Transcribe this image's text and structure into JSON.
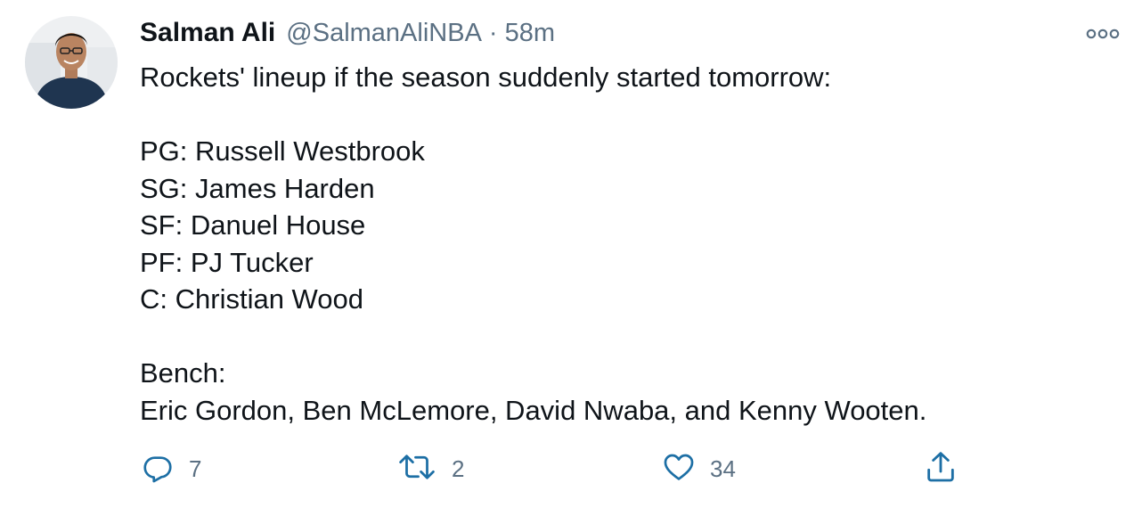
{
  "tweet": {
    "author_name": "Salman Ali",
    "author_handle": "@SalmanAliNBA",
    "separator": "·",
    "time": "58m",
    "lines": [
      "Rockets' lineup if the season suddenly started tomorrow:",
      "",
      "PG: Russell Westbrook",
      "SG: James Harden",
      "SF: Danuel House",
      "PF: PJ Tucker",
      "C: Christian Wood",
      "",
      "Bench:",
      "Eric Gordon, Ben McLemore, David Nwaba, and Kenny Wooten."
    ]
  },
  "actions": {
    "reply_count": "7",
    "retweet_count": "2",
    "like_count": "34"
  },
  "icons": {
    "more": "more-icon",
    "reply": "reply-icon",
    "retweet": "retweet-icon",
    "like": "heart-icon",
    "share": "share-icon"
  },
  "colors": {
    "text": "#0f1419",
    "secondary": "#5b7083",
    "icon": "#1d9bf0"
  }
}
